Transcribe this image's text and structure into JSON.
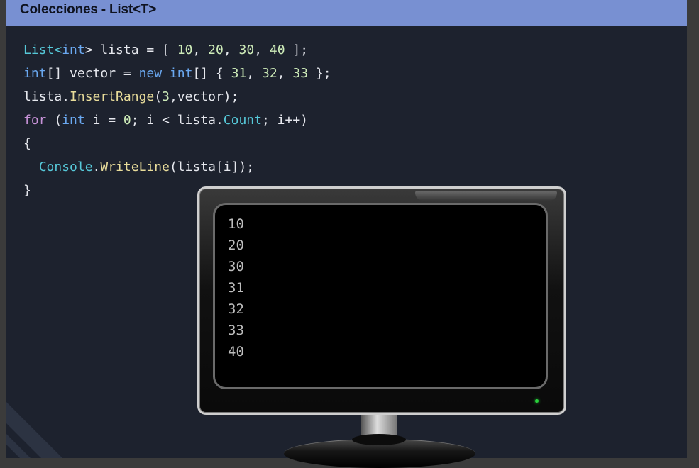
{
  "slide": {
    "title": "Colecciones - List<T>"
  },
  "code": {
    "line1": {
      "t1": "List<",
      "t2": "int",
      "t3": "> lista = [ ",
      "n1": "10",
      "c1": ", ",
      "n2": "20",
      "c2": ", ",
      "n3": "30",
      "c3": ", ",
      "n4": "40",
      "end": " ];"
    },
    "line2": {
      "t1": "int",
      "t2": "[] vector = ",
      "kw_new": "new",
      "sp": " ",
      "t3": "int",
      "t4": "[] { ",
      "n1": "31",
      "c1": ", ",
      "n2": "32",
      "c2": ", ",
      "n3": "33",
      "end": " };"
    },
    "line3": {
      "t1": "lista.",
      "m1": "InsertRange",
      "t2": "(",
      "n1": "3",
      "t3": ",vector);"
    },
    "line4": {
      "kw_for": "for",
      "t1": " (",
      "kw_int": "int",
      "t2": " i = ",
      "n1": "0",
      "t3": "; i < lista.",
      "prop": "Count",
      "t4": "; i++)"
    },
    "line5": "{",
    "line6": {
      "indent": "  ",
      "cls": "Console",
      "dot": ".",
      "m1": "WriteLine",
      "t1": "(lista[i]);"
    },
    "line7": "}"
  },
  "console_output": [
    "10",
    "20",
    "30",
    "31",
    "32",
    "33",
    "40"
  ],
  "colors": {
    "background": "#1d222e",
    "titlebar": "#7890d2",
    "type": "#56c8d8",
    "keyword": "#6aa8f0",
    "control": "#c792d8",
    "number": "#cdebb8",
    "method": "#e8dc9a",
    "led": "#29d23c"
  }
}
